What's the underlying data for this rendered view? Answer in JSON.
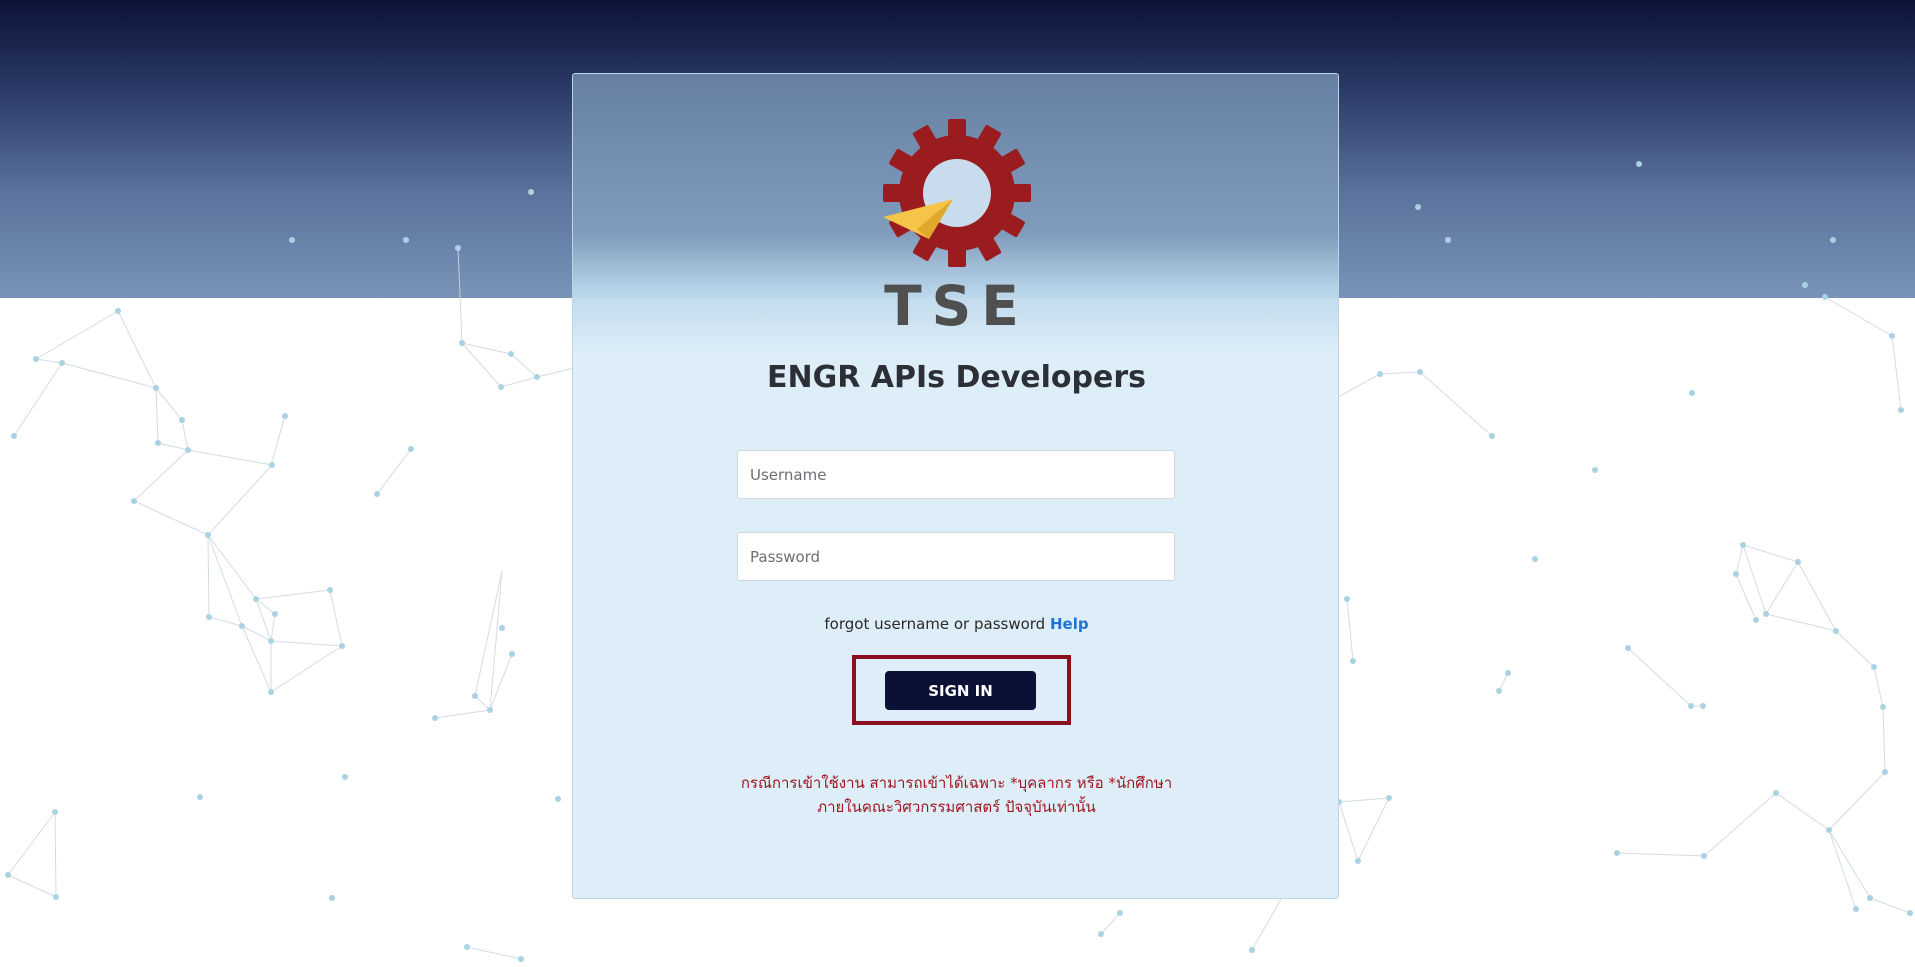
{
  "brand": {
    "logo_icon": "gear-compass-icon",
    "name": "TSE",
    "colors": {
      "gear": "#9b1c1f",
      "pointer": "#f6c446",
      "text": "#4f4f4f"
    }
  },
  "title": "ENGR APIs Developers",
  "form": {
    "username_placeholder": "Username",
    "password_placeholder": "Password"
  },
  "help": {
    "prefix": "forgot username or password",
    "link_label": "Help"
  },
  "sign_in_label": "SIGN IN",
  "notice": {
    "line1": "กรณีการเข้าใช้งาน สามารถเข้าได้เฉพาะ *บุคลากร หรือ *นักศึกษา",
    "line2": "ภายในคณะวิศวกรรมศาสตร์ ปัจจุบันเท่านั้น"
  },
  "theme": {
    "header_dark": "#0b1238",
    "button": "#0b1134",
    "highlight_border": "#8b0f1c",
    "notice": "#a0161f",
    "link": "#1f73d6",
    "network_line": "#cfd8de",
    "network_node": "#a9d3e2"
  }
}
